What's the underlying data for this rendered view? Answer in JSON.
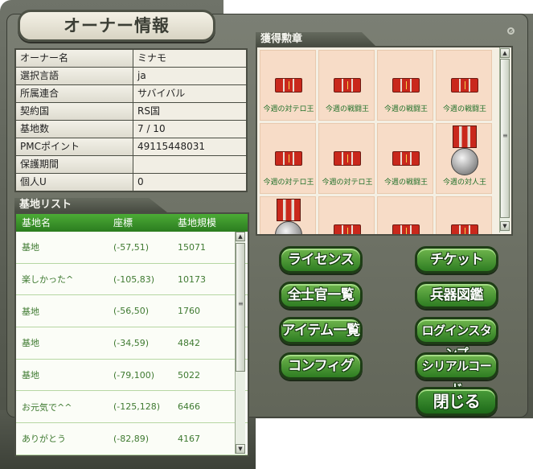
{
  "title": "オーナー情報",
  "owner_info": {
    "rows": [
      {
        "label": "オーナー名",
        "value": "ミナモ"
      },
      {
        "label": "選択言語",
        "value": "ja"
      },
      {
        "label": "所属連合",
        "value": "サバイバル"
      },
      {
        "label": "契約国",
        "value": "RS国"
      },
      {
        "label": "基地数",
        "value": "7 / 10"
      },
      {
        "label": "PMCポイント",
        "value": "49115448031"
      },
      {
        "label": "保護期間",
        "value": ""
      },
      {
        "label": "個人U",
        "value": "0"
      }
    ]
  },
  "base_list": {
    "section_title": "基地リスト",
    "headers": [
      "基地名",
      "座標",
      "基地規模"
    ],
    "rows": [
      {
        "name": "基地",
        "coords": "(-57,51)",
        "size": "15071"
      },
      {
        "name": "楽しかった^",
        "coords": "(-105,83)",
        "size": "10173"
      },
      {
        "name": "基地",
        "coords": "(-56,50)",
        "size": "1760"
      },
      {
        "name": "基地",
        "coords": "(-34,59)",
        "size": "4842"
      },
      {
        "name": "基地",
        "coords": "(-79,100)",
        "size": "5022"
      },
      {
        "name": "お元気で^^",
        "coords": "(-125,128)",
        "size": "6466"
      },
      {
        "name": "ありがとう",
        "coords": "(-82,89)",
        "size": "4167"
      }
    ]
  },
  "medals": {
    "section_title": "獲得勲章",
    "items": [
      {
        "caption": "今週の対テロ王",
        "kind": "ribbon"
      },
      {
        "caption": "今週の戦闘王",
        "kind": "ribbon"
      },
      {
        "caption": "今週の戦闘王",
        "kind": "ribbon"
      },
      {
        "caption": "今週の戦闘王",
        "kind": "ribbon"
      },
      {
        "caption": "今週の対テロ王",
        "kind": "ribbon"
      },
      {
        "caption": "今週の対テロ王",
        "kind": "ribbon"
      },
      {
        "caption": "今週の戦闘王",
        "kind": "ribbon"
      },
      {
        "caption": "今週の対人王",
        "kind": "medal"
      },
      {
        "caption": "",
        "kind": "medal"
      },
      {
        "caption": "",
        "kind": "ribbon"
      },
      {
        "caption": "",
        "kind": "ribbon"
      },
      {
        "caption": "",
        "kind": "ribbon"
      }
    ]
  },
  "buttons": {
    "license": "ライセンス",
    "ticket": "チケット",
    "officers": "全士官一覧",
    "weapons": "兵器図鑑",
    "items": "アイテム一覧",
    "login_stamp": "ログインスタンプ",
    "config": "コンフィグ",
    "serial_code": "シリアルコード",
    "close": "閉じる"
  },
  "colors": {
    "accent_green": "#2e7d22",
    "frame": "#626659",
    "list_header": "#3b9a2b",
    "list_text": "#3f7a31"
  },
  "icons": {
    "scroll_up": "▲",
    "scroll_down": "▼",
    "scroll_grip": "≡"
  }
}
